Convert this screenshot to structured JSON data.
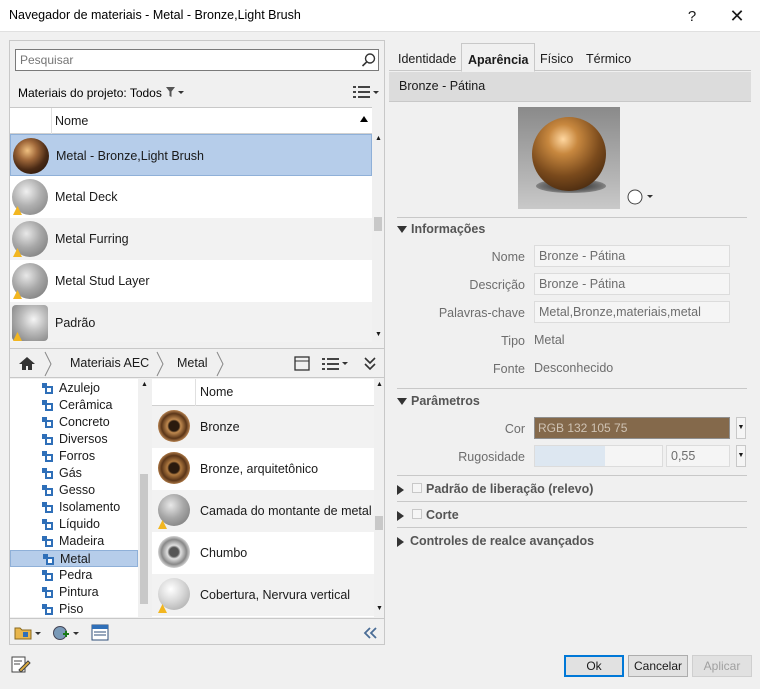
{
  "window": {
    "title": "Navegador de materiais - Metal - Bronze,Light Brush",
    "help": "?",
    "close": "✕"
  },
  "search": {
    "placeholder": "Pesquisar"
  },
  "project_filter": {
    "label": "Materiais do projeto: Todos"
  },
  "project_table": {
    "header": "Nome",
    "rows": [
      {
        "label": "Metal - Bronze,Light Brush",
        "selected": true
      },
      {
        "label": "Metal Deck"
      },
      {
        "label": "Metal Furring"
      },
      {
        "label": "Metal Stud Layer"
      },
      {
        "label": "Padrão"
      }
    ]
  },
  "breadcrumb": {
    "items": [
      "Materiais AEC",
      "Metal"
    ]
  },
  "library_tree": {
    "items": [
      "Azulejo",
      "Cerâmica",
      "Concreto",
      "Diversos",
      "Forros",
      "Gás",
      "Gesso",
      "Isolamento",
      "Líquido",
      "Madeira",
      "Metal",
      "Pedra",
      "Pintura",
      "Piso"
    ],
    "selected": "Metal"
  },
  "library_list": {
    "header": "Nome",
    "rows": [
      "Bronze",
      "Bronze, arquitetônico",
      "Camada do montante de metal",
      "Chumbo",
      "Cobertura, Nervura vertical"
    ]
  },
  "tabs": [
    "Identidade",
    "Aparência",
    "Físico",
    "Térmico"
  ],
  "active_tab": "Aparência",
  "asset": {
    "title": "Bronze - Pátina"
  },
  "info": {
    "section": "Informações",
    "name_label": "Nome",
    "name_value": "Bronze - Pátina",
    "desc_label": "Descrição",
    "desc_value": "Bronze - Pátina",
    "kw_label": "Palavras-chave",
    "kw_value": "Metal,Bronze,materiais,metal",
    "type_label": "Tipo",
    "type_value": "Metal",
    "source_label": "Fonte",
    "source_value": "Desconhecido"
  },
  "params": {
    "section": "Parâmetros",
    "color_label": "Cor",
    "color_value": "RGB 132 105 75",
    "color_hex": "#84694b",
    "rough_label": "Rugosidade",
    "rough_value": "0,55",
    "rough_fraction": 0.55
  },
  "collapsed": {
    "relief": "Padrão de liberação (relevo)",
    "cut": "Corte",
    "advanced": "Controles de realce avançados"
  },
  "footer": {
    "ok": "Ok",
    "cancel": "Cancelar",
    "apply": "Aplicar"
  }
}
